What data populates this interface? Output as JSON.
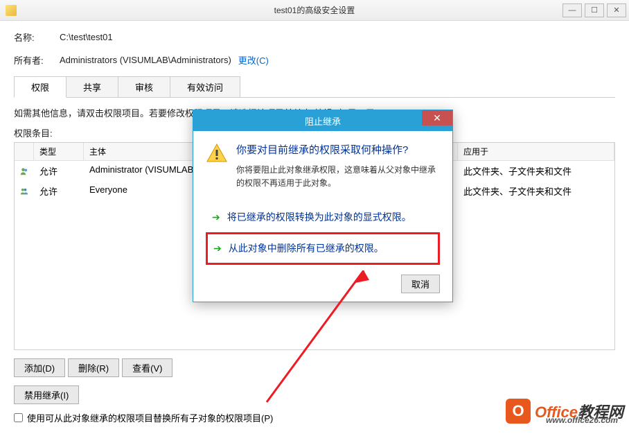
{
  "titlebar": {
    "title": "test01的高级安全设置"
  },
  "name": {
    "label": "名称:",
    "value": "C:\\test\\test01"
  },
  "owner": {
    "label": "所有者:",
    "value": "Administrators (VISUMLAB\\Administrators)",
    "change_link": "更改(C)"
  },
  "tabs": [
    "权限",
    "共享",
    "审核",
    "有效访问"
  ],
  "info_text": "如需其他信息，请双击权限项目。若要修改权限项目，请选择该项目并单击\"编辑\"(如果可用)。",
  "section_label": "权限条目:",
  "columns": {
    "type": "类型",
    "subject": "主体",
    "apply": "应用于"
  },
  "rows": [
    {
      "type": "允许",
      "subject": "Administrator (VISUMLAB",
      "apply": "此文件夹、子文件夹和文件"
    },
    {
      "type": "允许",
      "subject": "Everyone",
      "apply": "此文件夹、子文件夹和文件"
    }
  ],
  "buttons": {
    "add": "添加(D)",
    "remove": "删除(R)",
    "view": "查看(V)",
    "disable_inherit": "禁用继承(I)"
  },
  "checkbox_label": "使用可从此对象继承的权限项目替换所有子对象的权限项目(P)",
  "modal": {
    "title": "阻止继承",
    "heading": "你要对目前继承的权限采取何种操作?",
    "desc": "你将要阻止此对象继承权限，这意味着从父对象中继承的权限不再适用于此对象。",
    "option1": "将已继承的权限转换为此对象的显式权限。",
    "option2": "从此对象中删除所有已继承的权限。",
    "cancel": "取消"
  },
  "watermark": {
    "text1": "Office",
    "text2": "教程网",
    "url": "www.office26.com"
  }
}
